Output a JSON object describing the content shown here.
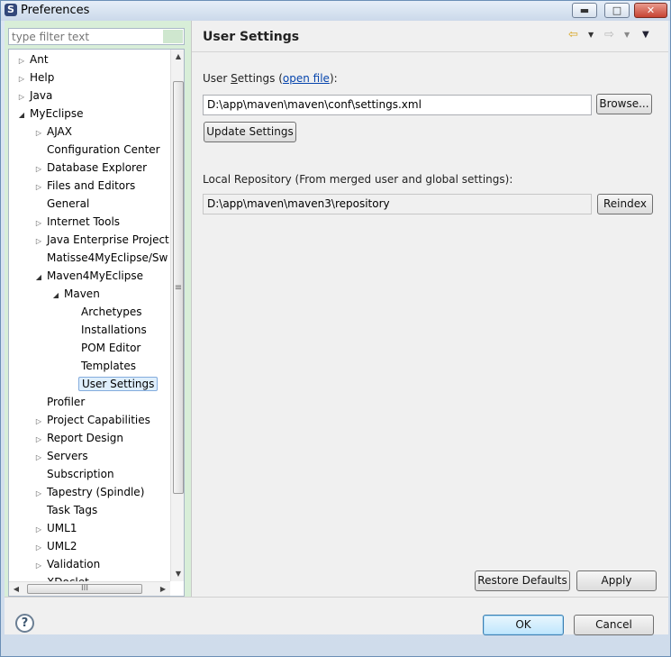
{
  "window": {
    "title": "Preferences",
    "app_icon": "myeclipse-logo-icon",
    "minimize": "▬",
    "maximize": "□",
    "close": "✕"
  },
  "filter": {
    "placeholder": "type filter text"
  },
  "tree": {
    "items": [
      {
        "label": "Ant",
        "level": 0,
        "twisty": "collapsed"
      },
      {
        "label": "Help",
        "level": 0,
        "twisty": "collapsed"
      },
      {
        "label": "Java",
        "level": 0,
        "twisty": "collapsed"
      },
      {
        "label": "MyEclipse",
        "level": 0,
        "twisty": "expanded"
      },
      {
        "label": "AJAX",
        "level": 1,
        "twisty": "collapsed"
      },
      {
        "label": "Configuration Center",
        "level": 1,
        "twisty": "none"
      },
      {
        "label": "Database Explorer",
        "level": 1,
        "twisty": "collapsed"
      },
      {
        "label": "Files and Editors",
        "level": 1,
        "twisty": "collapsed"
      },
      {
        "label": "General",
        "level": 1,
        "twisty": "none"
      },
      {
        "label": "Internet Tools",
        "level": 1,
        "twisty": "collapsed"
      },
      {
        "label": "Java Enterprise Project",
        "level": 1,
        "twisty": "collapsed"
      },
      {
        "label": "Matisse4MyEclipse/Sw",
        "level": 1,
        "twisty": "none"
      },
      {
        "label": "Maven4MyEclipse",
        "level": 1,
        "twisty": "expanded"
      },
      {
        "label": "Maven",
        "level": 2,
        "twisty": "expanded"
      },
      {
        "label": "Archetypes",
        "level": 3,
        "twisty": "none"
      },
      {
        "label": "Installations",
        "level": 3,
        "twisty": "none"
      },
      {
        "label": "POM Editor",
        "level": 3,
        "twisty": "none"
      },
      {
        "label": "Templates",
        "level": 3,
        "twisty": "none"
      },
      {
        "label": "User Settings",
        "level": 3,
        "twisty": "none",
        "selected": true
      },
      {
        "label": "Profiler",
        "level": 1,
        "twisty": "none"
      },
      {
        "label": "Project Capabilities",
        "level": 1,
        "twisty": "collapsed"
      },
      {
        "label": "Report Design",
        "level": 1,
        "twisty": "collapsed"
      },
      {
        "label": "Servers",
        "level": 1,
        "twisty": "collapsed"
      },
      {
        "label": "Subscription",
        "level": 1,
        "twisty": "none"
      },
      {
        "label": "Tapestry (Spindle)",
        "level": 1,
        "twisty": "collapsed"
      },
      {
        "label": "Task Tags",
        "level": 1,
        "twisty": "none"
      },
      {
        "label": "UML1",
        "level": 1,
        "twisty": "collapsed"
      },
      {
        "label": "UML2",
        "level": 1,
        "twisty": "collapsed"
      },
      {
        "label": "Validation",
        "level": 1,
        "twisty": "collapsed"
      },
      {
        "label": "XDoclet",
        "level": 1,
        "twisty": "collapsed"
      }
    ]
  },
  "page": {
    "title": "User Settings",
    "user_settings_label_prefix": "User ",
    "user_settings_label_accel": "S",
    "user_settings_label_rest": "ettings (",
    "open_file_link": "open file",
    "user_settings_label_suffix": "):",
    "user_settings_path": "D:\\app\\maven\\maven\\conf\\settings.xml",
    "browse_button": "Browse...",
    "update_button": "Update Settings",
    "local_repo_label": "Local Repository (From merged user and global settings):",
    "local_repo_path": "D:\\app\\maven\\maven3\\repository",
    "reindex_button": "Reindex",
    "restore_defaults_button": "Restore Defaults",
    "apply_button": "Apply"
  },
  "dialog": {
    "help_label": "?",
    "ok_button": "OK",
    "cancel_button": "Cancel"
  },
  "colors": {
    "left_panel_bg": "#d8eed8",
    "selection_border": "#84acdd",
    "link": "#0645ad",
    "primary_button_border": "#3c7fb1"
  }
}
